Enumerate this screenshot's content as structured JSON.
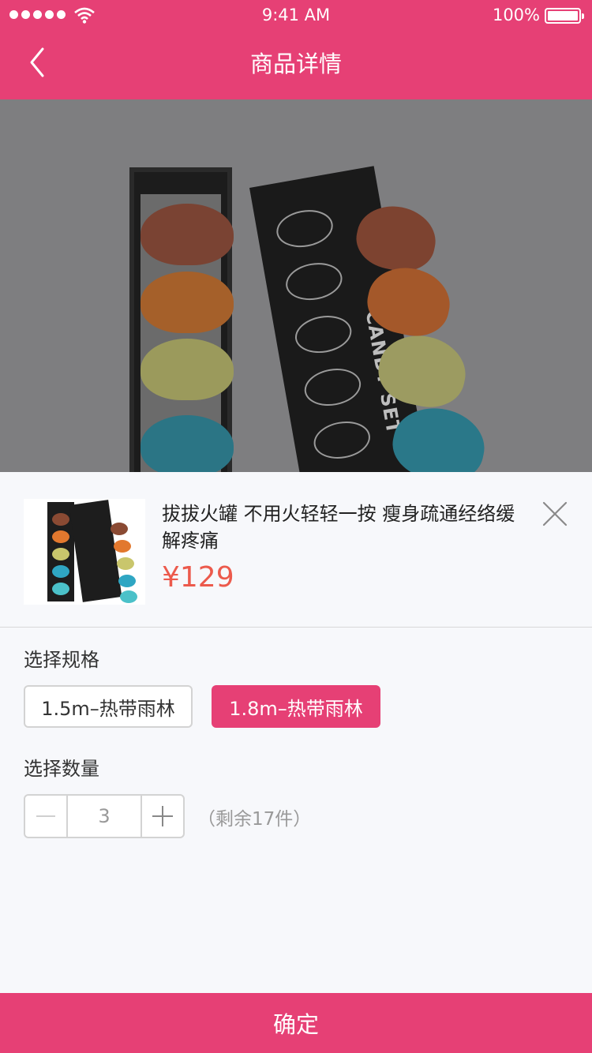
{
  "status_bar": {
    "time": "9:41 AM",
    "battery": "100%"
  },
  "nav": {
    "title": "商品详情",
    "back_icon": "chevron-left-icon"
  },
  "product": {
    "title": "拔拔火罐 不用火轻轻一按 瘦身疏通经络缓解疼痛",
    "price": "¥129",
    "hero_lid_text": "CANDY SET"
  },
  "spec_section": {
    "label": "选择规格",
    "options": [
      {
        "label": "1.5m–热带雨林",
        "selected": false
      },
      {
        "label": "1.8m–热带雨林",
        "selected": true
      }
    ]
  },
  "quantity_section": {
    "label": "选择数量",
    "value": "3",
    "stock": "（剩余17件）"
  },
  "confirm_button": "确定",
  "colors": {
    "brand": "#e64075",
    "price": "#ec5a4c",
    "sheet_bg": "#f7f8fb"
  }
}
